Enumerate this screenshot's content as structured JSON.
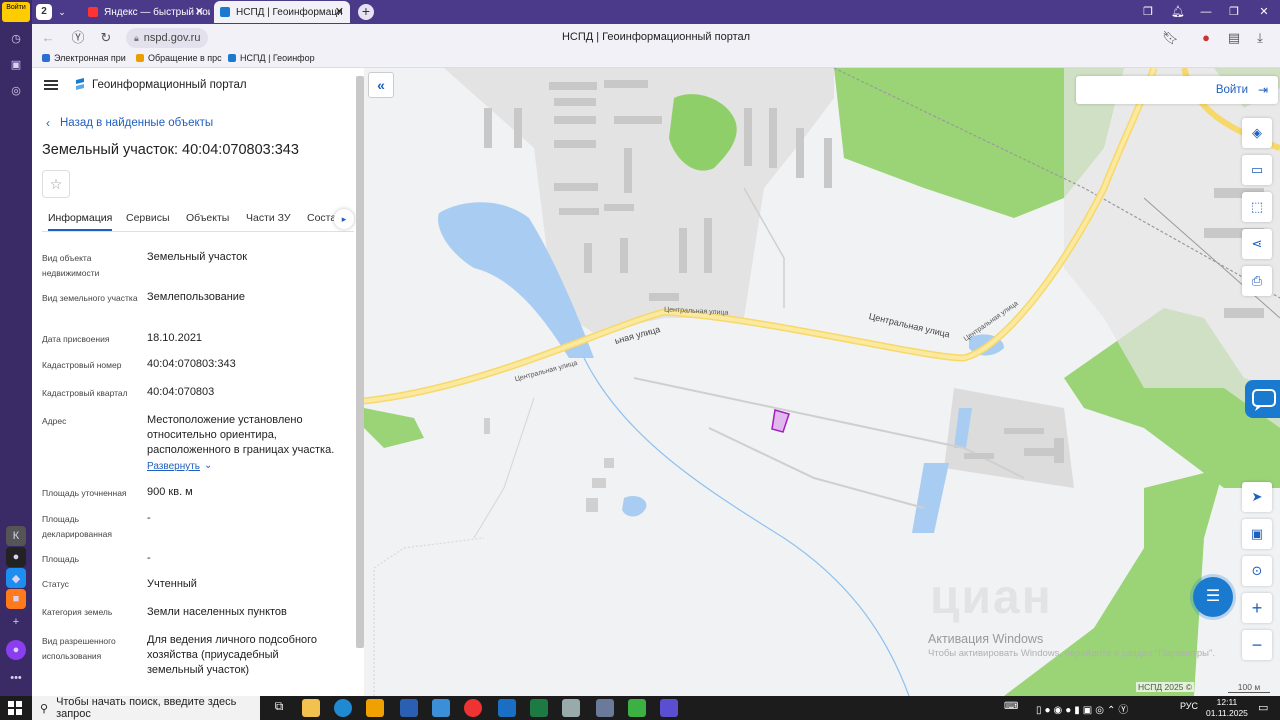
{
  "browser": {
    "tab_counter": "2",
    "tabs": [
      {
        "title": "Яндекс — быстрый поиск",
        "active": false
      },
      {
        "title": "НСПД | Геоинформаци",
        "active": true
      }
    ],
    "url": "nspd.gov.ru",
    "page_title": "НСПД | Геоинформационный портал",
    "bookmarks": [
      "Электронная при",
      "Обращение в прс",
      "НСПД | Геоинфор"
    ],
    "login_badge": "Войти"
  },
  "panel": {
    "portal_name": "Геоинформационный портал",
    "back_link": "Назад в найденные объекты",
    "title": "Земельный участок: 40:04:070803:343",
    "tabs": [
      "Информация",
      "Сервисы",
      "Объекты",
      "Части ЗУ",
      "Состав"
    ],
    "fields": [
      {
        "label": "Вид объекта недвижимости",
        "value": "Земельный участок"
      },
      {
        "label": "Вид земельного участка",
        "value": "Землепользование"
      },
      {
        "label": "Дата присвоения",
        "value": "18.10.2021"
      },
      {
        "label": "Кадастровый номер",
        "value": "40:04:070803:343"
      },
      {
        "label": "Кадастровый квартал",
        "value": "40:04:070803"
      },
      {
        "label": "Адрес",
        "value": "Местоположение установлено относительно ориентира, расположенного в границах участка."
      },
      {
        "label": "Площадь уточненная",
        "value": "900 кв. м"
      },
      {
        "label": "Площадь декларированная",
        "value": "-"
      },
      {
        "label": "Площадь",
        "value": "-"
      },
      {
        "label": "Статус",
        "value": "Учтенный"
      },
      {
        "label": "Категория земель",
        "value": "Земли населенных пунктов"
      },
      {
        "label": "Вид разрешенного использования",
        "value": "Для ведения личного подсобного хозяйства (приусадебный земельный участок)"
      }
    ],
    "expand_link": "Развернуть"
  },
  "map": {
    "login": "Войти",
    "street_1": "Центральная улица",
    "street_2": "Центральная улица",
    "street_3": "ьная улица",
    "street_4": "Центральная улица",
    "street_5": "Центральная улица",
    "watermark_title": "Активация Windows",
    "watermark_sub": "Чтобы активировать Windows, перейдите в раздел \"Параметры\".",
    "cian": "циан",
    "copyright": "НСПД 2025 ©",
    "scale": "100 м",
    "parcel_color": "#a020c0"
  },
  "taskbar": {
    "search_placeholder": "Чтобы начать поиск, введите здесь запрос",
    "lang": "РУС",
    "time": "12:11",
    "date": "01.11.2025"
  }
}
